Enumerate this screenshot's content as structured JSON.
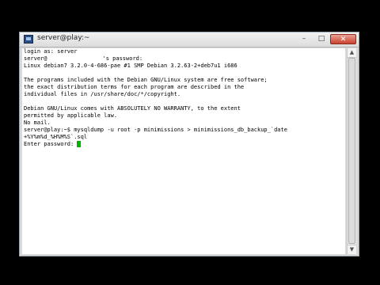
{
  "window": {
    "title": "server@play:~",
    "minimize": "–",
    "maximize": "□",
    "close": "✕"
  },
  "terminal": {
    "login_line": "login as: server",
    "password_prefix": "server@",
    "password_suffix": "'s password:",
    "kernel_line": "Linux debian7 3.2.0-4-686-pae #1 SMP Debian 3.2.63-2+deb7u1 i686",
    "license_lines": [
      "The programs included with the Debian GNU/Linux system are free software;",
      "the exact distribution terms for each program are described in the",
      "individual files in /usr/share/doc/*/copyright."
    ],
    "warranty_lines": [
      "Debian GNU/Linux comes with ABSOLUTELY NO WARRANTY, to the extent",
      "permitted by applicable law."
    ],
    "mail_line": "No mail.",
    "command_line_1": "server@play:~$ mysqldump -u root -p minimissions > minimissions_db_backup_`date",
    "command_line_2": "+%Y%m%d_%H%M%S`.sql",
    "prompt_line": "Enter password: "
  },
  "scrollbar": {
    "up_arrow": "▲",
    "down_arrow": "▼"
  },
  "colors": {
    "cursor": "#00b300",
    "terminal_bg": "#ffffff",
    "close_button": "#c7432f"
  }
}
